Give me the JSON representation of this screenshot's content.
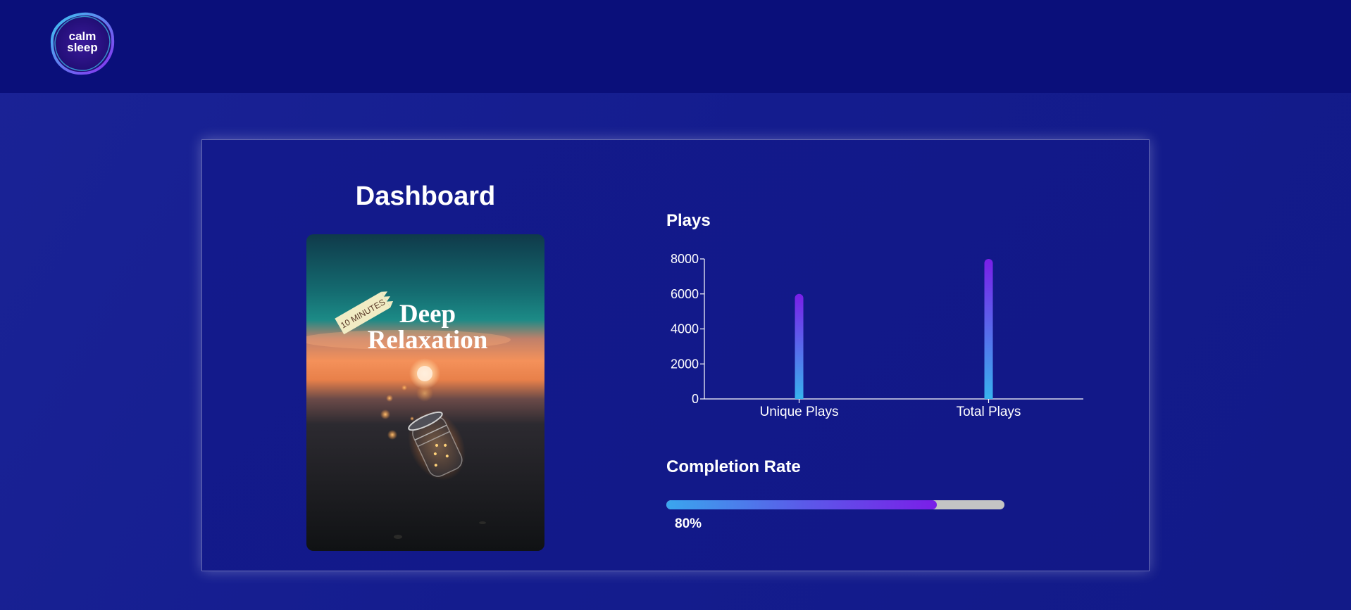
{
  "header": {
    "logo_line1": "calm",
    "logo_line2": "sleep"
  },
  "dashboard": {
    "title": "Dashboard",
    "cover": {
      "badge": "10 MINUTES",
      "title_line1": "Deep",
      "title_line2": "Relaxation"
    }
  },
  "plays": {
    "title": "Plays"
  },
  "chart_data": {
    "type": "bar",
    "categories": [
      "Unique Plays",
      "Total Plays"
    ],
    "values": [
      6000,
      8000
    ],
    "title": "Plays",
    "xlabel": "",
    "ylabel": "",
    "ylim": [
      0,
      8000
    ],
    "yticks": [
      0,
      2000,
      4000,
      6000,
      8000
    ],
    "grid": false,
    "colors": {
      "bar_top": "#7a1ee8",
      "bar_bottom": "#38b2ee"
    }
  },
  "completion": {
    "title": "Completion Rate",
    "value": 80,
    "label": "80%"
  },
  "colors": {
    "background": "#141c8e",
    "header": "#0a0f7a",
    "progress_track": "#c4c4c4"
  }
}
